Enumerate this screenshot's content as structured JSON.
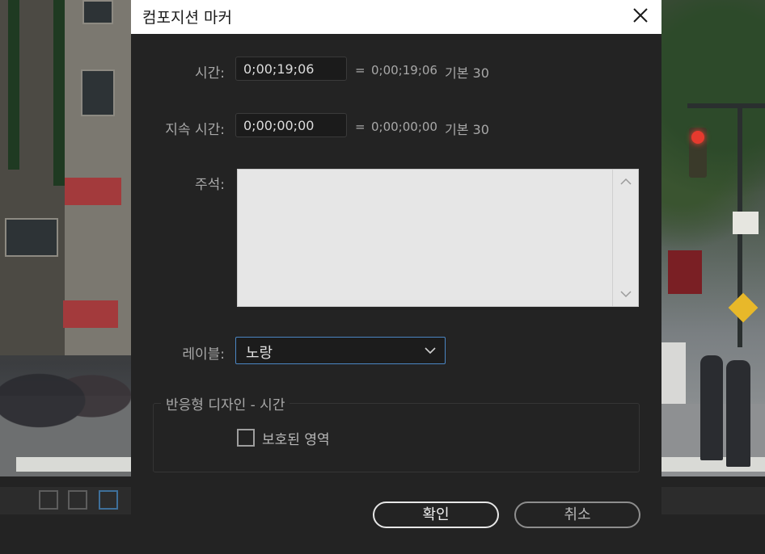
{
  "dialog": {
    "title": "컴포지션 마커"
  },
  "time": {
    "label": "시간:",
    "value": "0;00;19;06",
    "equals": "=",
    "equivalent": "0;00;19;06",
    "base": "기본 30"
  },
  "duration": {
    "label": "지속 시간:",
    "value": "0;00;00;00",
    "equals": "=",
    "equivalent": "0;00;00;00",
    "base": "기본 30"
  },
  "comment": {
    "label": "주석:",
    "value": ""
  },
  "label_field": {
    "label": "레이블:",
    "selected": "노랑"
  },
  "responsive": {
    "legend": "반응형 디자인 - 시간",
    "checkbox_label": "보호된 영역",
    "checked": false
  },
  "buttons": {
    "ok": "확인",
    "cancel": "취소"
  },
  "colors": {
    "dialog_bg": "#232323",
    "titlebar_bg": "#ffffff",
    "focus_border": "#4b86c3"
  },
  "icons": {
    "close": "close-icon",
    "dropdown": "chevron-down-icon",
    "scroll_up": "chevron-up-icon",
    "scroll_down": "chevron-down-icon"
  }
}
